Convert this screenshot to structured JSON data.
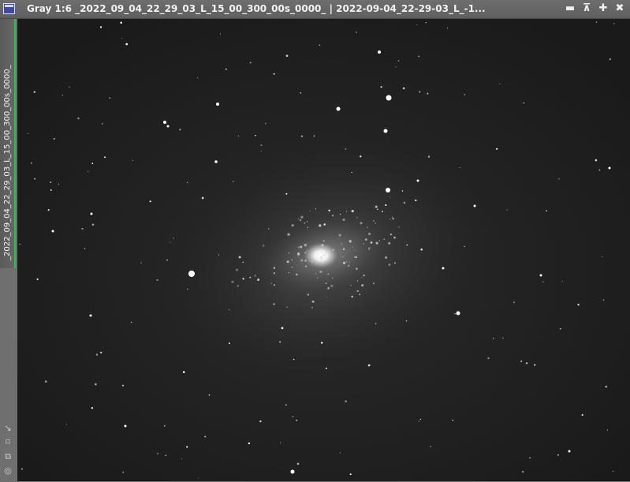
{
  "window": {
    "title": "Gray 1:6 _2022_09_04_22_29_03_L_15_00_300_00s_0000_ | 2022-09-04_22-29-03_L_-1...",
    "view_label": "_2022_09_04_22_29_03_L_15_00_300_00s_0000_",
    "controls": {
      "minimize": "▬",
      "shade": "⊼",
      "maximize": "✚",
      "close": "✖"
    },
    "tools": [
      "↘",
      "⌑",
      "⧉",
      "◎"
    ],
    "accent_color": "#2dbb55",
    "icon_color": "#3d4aa0"
  },
  "image": {
    "type": "grayscale astronomical image",
    "subject": "spiral galaxy with field stars",
    "background_color": "#1c1c1c"
  }
}
